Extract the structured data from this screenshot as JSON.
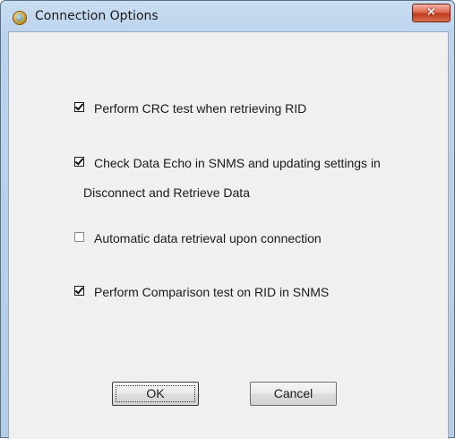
{
  "window": {
    "title": "Connection Options",
    "close_glyph": "×"
  },
  "options": [
    {
      "label": "Perform CRC test when retrieving RID",
      "checked": true
    },
    {
      "label": "Check Data Echo in SNMS and updating settings in",
      "label_line2": "Disconnect and Retrieve Data",
      "checked": true
    },
    {
      "label": "Automatic data retrieval upon connection",
      "checked": false
    },
    {
      "label": "Perform Comparison test on  RID in SNMS",
      "checked": true
    }
  ],
  "buttons": {
    "ok_label": "OK",
    "cancel_label": "Cancel"
  },
  "colors": {
    "title_bar": "#c9ddf1",
    "client_bg": "#f0f0f0",
    "close_button": "#c23a1f"
  },
  "icons": {
    "app": "app-globe-icon",
    "close": "close-icon"
  }
}
